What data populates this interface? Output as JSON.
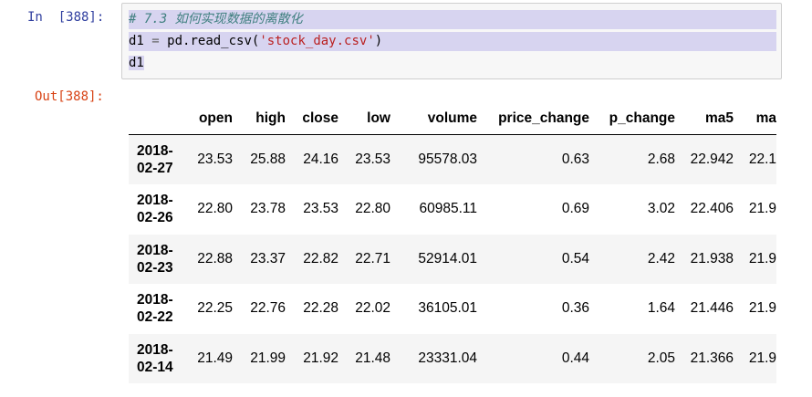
{
  "input_cell": {
    "prompt": "In  [388]:",
    "code": {
      "comment": "# 7.3 如何实现数据的离散化",
      "line2_var": "d1",
      "line2_op": "=",
      "line2_call": "pd.read_csv(",
      "line2_arg": "'stock_day.csv'",
      "line2_close": ")",
      "line3": "d1"
    }
  },
  "output_cell": {
    "prompt": "Out[388]:",
    "table": {
      "columns": [
        "open",
        "high",
        "close",
        "low",
        "volume",
        "price_change",
        "p_change",
        "ma5",
        "ma"
      ],
      "rows": [
        {
          "index": [
            "2018-",
            "02-27"
          ],
          "values": [
            "23.53",
            "25.88",
            "24.16",
            "23.53",
            "95578.03",
            "0.63",
            "2.68",
            "22.942",
            "22.1"
          ]
        },
        {
          "index": [
            "2018-",
            "02-26"
          ],
          "values": [
            "22.80",
            "23.78",
            "23.53",
            "22.80",
            "60985.11",
            "0.69",
            "3.02",
            "22.406",
            "21.9"
          ]
        },
        {
          "index": [
            "2018-",
            "02-23"
          ],
          "values": [
            "22.88",
            "23.37",
            "22.82",
            "22.71",
            "52914.01",
            "0.54",
            "2.42",
            "21.938",
            "21.9"
          ]
        },
        {
          "index": [
            "2018-",
            "02-22"
          ],
          "values": [
            "22.25",
            "22.76",
            "22.28",
            "22.02",
            "36105.01",
            "0.36",
            "1.64",
            "21.446",
            "21.9"
          ]
        },
        {
          "index": [
            "2018-",
            "02-14"
          ],
          "values": [
            "21.49",
            "21.99",
            "21.92",
            "21.48",
            "23331.04",
            "0.44",
            "2.05",
            "21.366",
            "21.9"
          ]
        }
      ]
    }
  }
}
